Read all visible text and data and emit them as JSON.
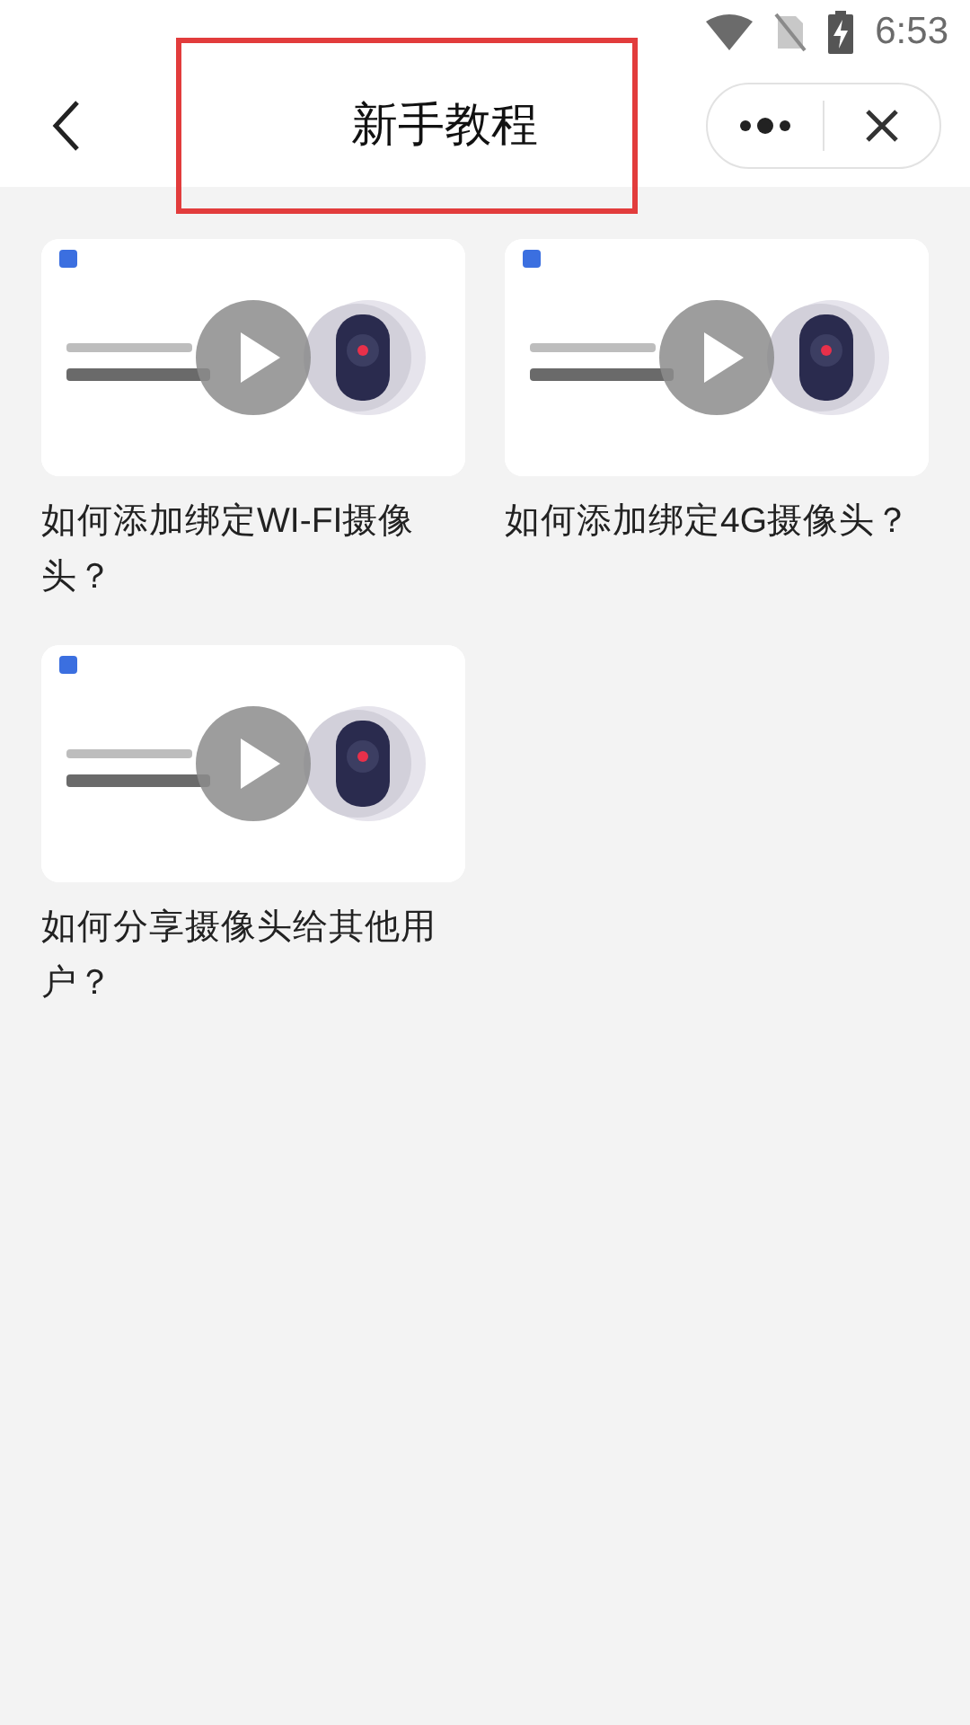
{
  "status_bar": {
    "time": "6:53"
  },
  "nav_bar": {
    "title": "新手教程"
  },
  "videos": [
    {
      "title": "如何添加绑定WI-FI摄像头？"
    },
    {
      "title": "如何添加绑定4G摄像头？"
    },
    {
      "title": "如何分享摄像头给其他用户？"
    }
  ]
}
